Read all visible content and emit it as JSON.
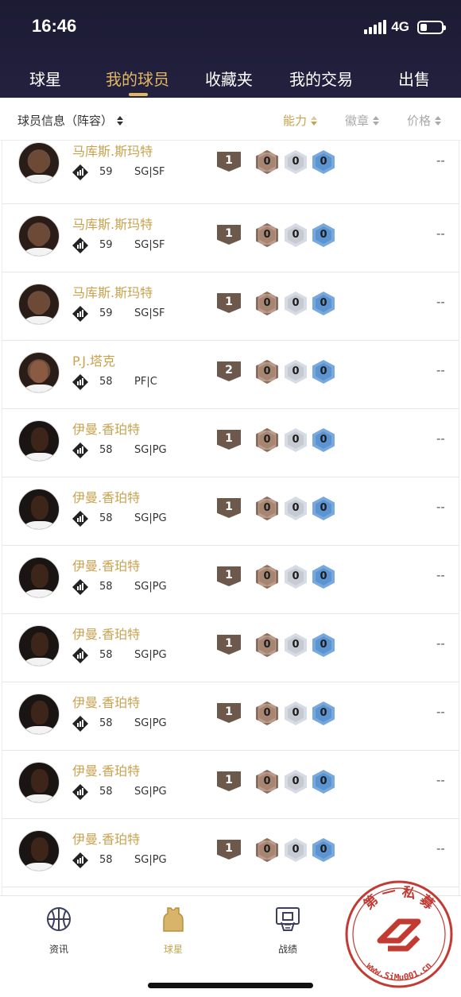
{
  "status": {
    "time": "16:46",
    "network": "4G",
    "battery_level": 0.3
  },
  "tabs": [
    {
      "label": "球星",
      "active": false
    },
    {
      "label": "我的球员",
      "active": true
    },
    {
      "label": "收藏夹",
      "active": false
    },
    {
      "label": "我的交易",
      "active": false
    },
    {
      "label": "出售",
      "active": false
    }
  ],
  "sortbar": {
    "info_label": "球员信息（阵容）",
    "ability_label": "能力",
    "badge_label": "徽章",
    "price_label": "价格"
  },
  "players": [
    {
      "name": "马库斯.斯玛特",
      "rating": "59",
      "position": "SG|SF",
      "level": "1",
      "bronze": "0",
      "silver": "0",
      "gold": "0",
      "price": "--"
    },
    {
      "name": "马库斯.斯玛特",
      "rating": "59",
      "position": "SG|SF",
      "level": "1",
      "bronze": "0",
      "silver": "0",
      "gold": "0",
      "price": "--"
    },
    {
      "name": "马库斯.斯玛特",
      "rating": "59",
      "position": "SG|SF",
      "level": "1",
      "bronze": "0",
      "silver": "0",
      "gold": "0",
      "price": "--"
    },
    {
      "name": "P.J.塔克",
      "rating": "58",
      "position": "PF|C",
      "level": "2",
      "bronze": "0",
      "silver": "0",
      "gold": "0",
      "price": "--"
    },
    {
      "name": "伊曼.香珀特",
      "rating": "58",
      "position": "SG|PG",
      "level": "1",
      "bronze": "0",
      "silver": "0",
      "gold": "0",
      "price": "--"
    },
    {
      "name": "伊曼.香珀特",
      "rating": "58",
      "position": "SG|PG",
      "level": "1",
      "bronze": "0",
      "silver": "0",
      "gold": "0",
      "price": "--"
    },
    {
      "name": "伊曼.香珀特",
      "rating": "58",
      "position": "SG|PG",
      "level": "1",
      "bronze": "0",
      "silver": "0",
      "gold": "0",
      "price": "--"
    },
    {
      "name": "伊曼.香珀特",
      "rating": "58",
      "position": "SG|PG",
      "level": "1",
      "bronze": "0",
      "silver": "0",
      "gold": "0",
      "price": "--"
    },
    {
      "name": "伊曼.香珀特",
      "rating": "58",
      "position": "SG|PG",
      "level": "1",
      "bronze": "0",
      "silver": "0",
      "gold": "0",
      "price": "--"
    },
    {
      "name": "伊曼.香珀特",
      "rating": "58",
      "position": "SG|PG",
      "level": "1",
      "bronze": "0",
      "silver": "0",
      "gold": "0",
      "price": "--"
    },
    {
      "name": "伊曼.香珀特",
      "rating": "58",
      "position": "SG|PG",
      "level": "1",
      "bronze": "0",
      "silver": "0",
      "gold": "0",
      "price": "--"
    }
  ],
  "bottom_nav": [
    {
      "label": "资讯",
      "icon": "basketball-icon",
      "active": false
    },
    {
      "label": "球星",
      "icon": "jersey-icon",
      "active": true
    },
    {
      "label": "战绩",
      "icon": "hoop-icon",
      "active": false
    }
  ],
  "watermark": {
    "top_text": "第 一 私 募",
    "bottom_text": "www.SiMu001.cn"
  },
  "colors": {
    "header_bg": "#1c1b33",
    "accent_gold": "#c9a24e",
    "active_tab": "#e2b865",
    "seal_red": "#c23b33"
  }
}
